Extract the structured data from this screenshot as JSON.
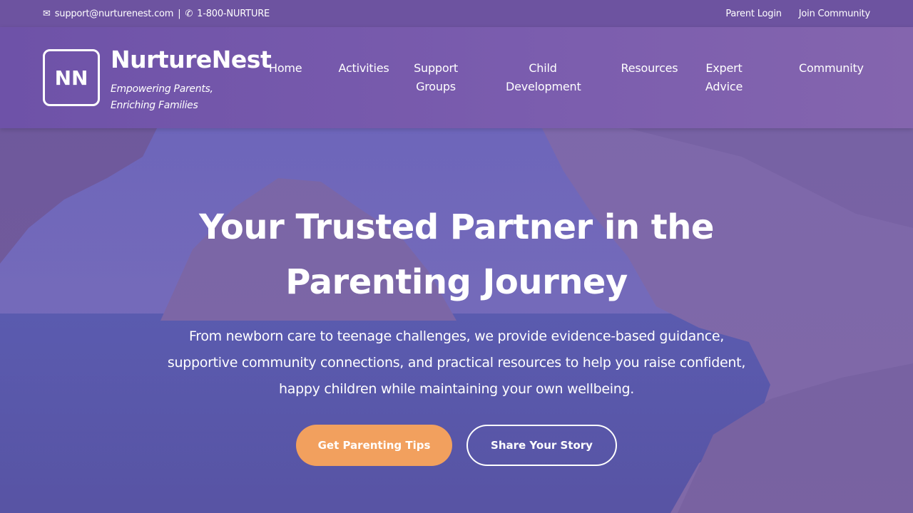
{
  "topbar": {
    "email_icon": "envelope-icon",
    "email": "support@nurturenest.com",
    "separator": "|",
    "phone_icon": "phone-icon",
    "phone": "1-800-NURTURE",
    "links": [
      "Parent Login",
      "Join Community"
    ]
  },
  "brand": {
    "logo_text": "NN",
    "name": "NurtureNest",
    "tagline": "Empowering Parents, Enriching Families"
  },
  "nav": {
    "items": [
      {
        "label": "Home"
      },
      {
        "label": "Activities"
      },
      {
        "label": "Support Groups"
      },
      {
        "label": "Child Development"
      },
      {
        "label": "Resources"
      },
      {
        "label": "Expert Advice"
      },
      {
        "label": "Community"
      }
    ]
  },
  "hero": {
    "title": "Your Trusted Partner in the Parenting Journey",
    "text": "From newborn care to teenage challenges, we provide evidence-based guidance, supportive community connections, and practical resources to help you raise confident, happy children while maintaining your own wellbeing.",
    "primary_button": "Get Parenting Tips",
    "secondary_button": "Share Your Story"
  },
  "colors": {
    "brand_purple": "#6e52a8",
    "accent_orange": "#f2a05e"
  }
}
